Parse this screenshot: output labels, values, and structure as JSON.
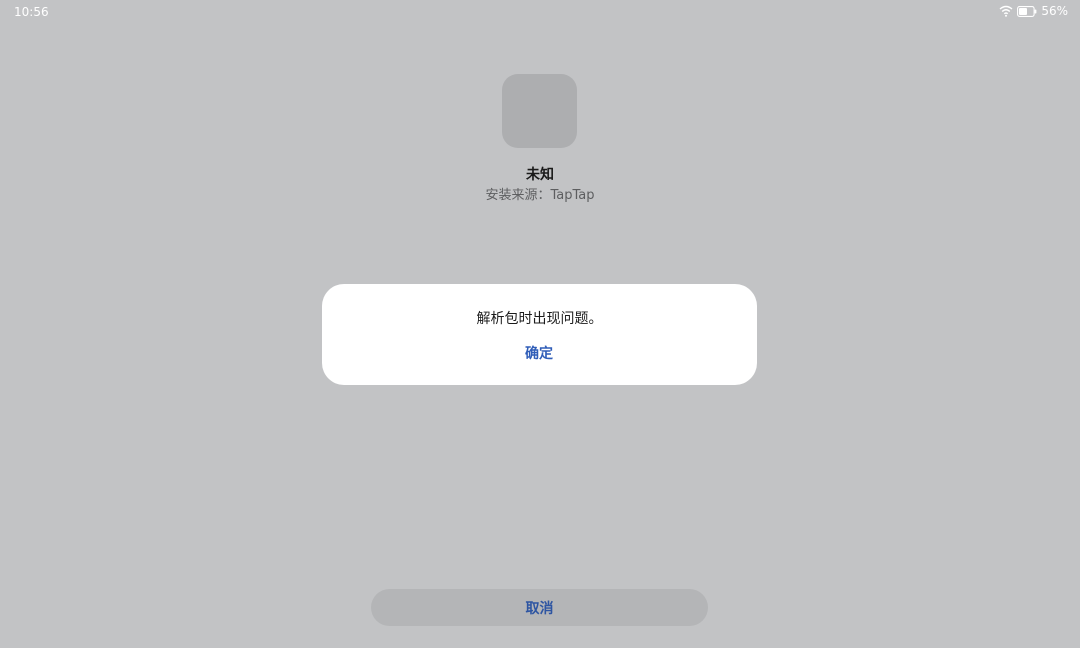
{
  "status_bar": {
    "time": "10:56",
    "battery": "56%",
    "battery_level": 0.56,
    "icons": [
      "wifi-icon",
      "battery-icon"
    ]
  },
  "app": {
    "name": "未知",
    "source": "安装来源：TapTap"
  },
  "dialog": {
    "message": "解析包时出现问题。",
    "confirm_label": "确定"
  },
  "bottom": {
    "cancel_label": "取消"
  },
  "colors": {
    "background": "#c2c3c5",
    "dialog": "#ffffff",
    "accent": "#2f5db8",
    "app_icon_placeholder": "#adaeb0"
  }
}
